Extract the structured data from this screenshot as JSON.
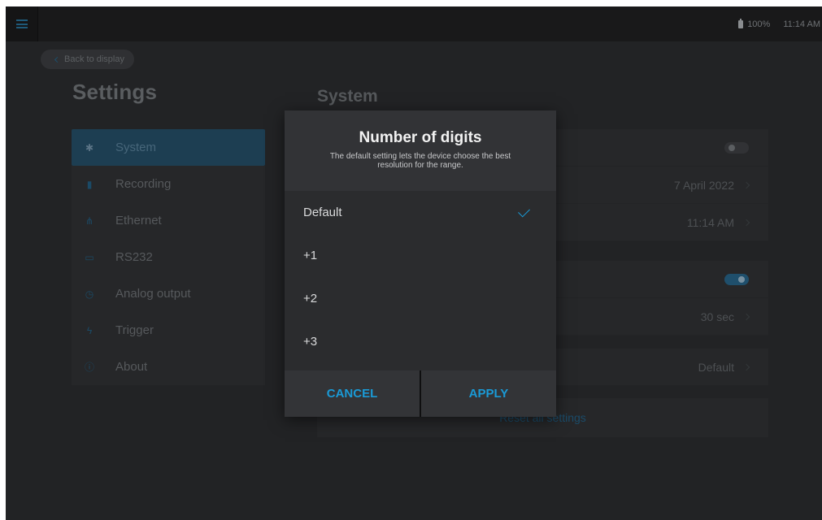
{
  "status": {
    "battery": "100%",
    "time": "11:14 AM"
  },
  "back_button": "Back to display",
  "settings_title": "Settings",
  "section_title": "System",
  "sidebar": {
    "items": [
      {
        "label": "System",
        "icon": "gear-icon",
        "active": true
      },
      {
        "label": "Recording",
        "icon": "file-icon"
      },
      {
        "label": "Ethernet",
        "icon": "network-icon"
      },
      {
        "label": "RS232",
        "icon": "serial-port-icon"
      },
      {
        "label": "Analog output",
        "icon": "gauge-icon"
      },
      {
        "label": "Trigger",
        "icon": "bolt-icon"
      },
      {
        "label": "About",
        "icon": "info-icon"
      }
    ]
  },
  "system_rows": {
    "date": "7 April 2022",
    "time": "11:14 AM",
    "auto_off": "30 sec",
    "digits": "Default",
    "reset": "Reset all settings"
  },
  "dialog": {
    "title": "Number of digits",
    "description": "The default setting lets the device choose the best resolution for the range.",
    "options": [
      "Default",
      "+1",
      "+2",
      "+3"
    ],
    "selected": "Default",
    "cancel": "CANCEL",
    "apply": "APPLY"
  },
  "colors": {
    "accent": "#1a9ad6",
    "background": "#222325"
  }
}
